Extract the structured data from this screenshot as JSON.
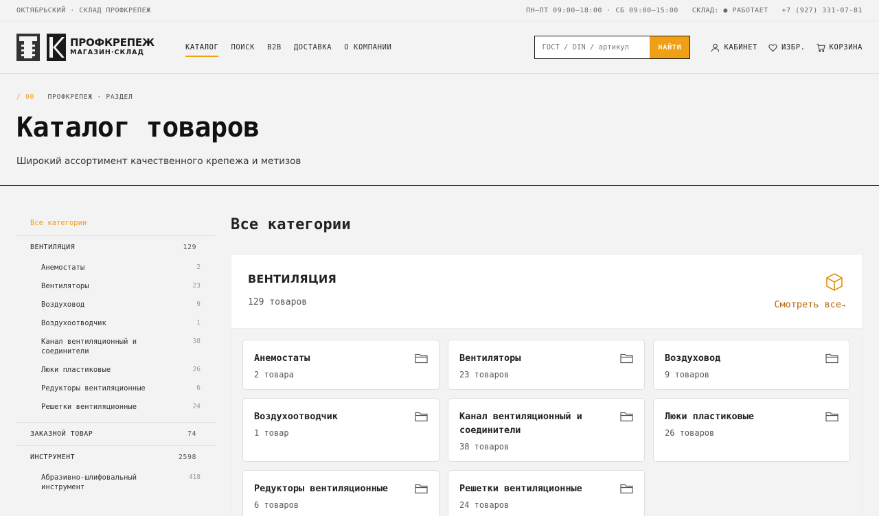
{
  "topbar": {
    "location": "ОКТЯБРЬСКИЙ · СКЛАД ПРОФКРЕПЕЖ",
    "hours": "ПН–ПТ 09:00–18:00 · СБ 09:00–15:00",
    "status": "СКЛАД: ● РАБОТАЕТ",
    "phone": "+7 (927) 331-07-81"
  },
  "header": {
    "logo_name": "ПРОФКРЕПЕЖ",
    "logo_sub": "МАГАЗИН·СКЛАД",
    "nav": [
      "КАТАЛОГ",
      "ПОИСК",
      "B2B",
      "ДОСТАВКА",
      "О КОМПАНИИ"
    ],
    "search_placeholder": "ГОСТ / DIN / артикул",
    "search_button": "НАЙТИ",
    "tools": {
      "cabinet": "КАБИНЕТ",
      "favorites": "ИЗБР.",
      "cart": "КОРЗИНА"
    },
    "accent": "#f0a015"
  },
  "hero": {
    "crumb_num": "/ 00",
    "crumb_text": "ПРОФКРЕПЕЖ · РАЗДЕЛ",
    "title": "Каталог товаров",
    "subtitle": "Широкий ассортимент качественного крепежа и метизов"
  },
  "sidebar": {
    "all": "Все категории",
    "groups": [
      {
        "name": "ВЕНТИЛЯЦИЯ",
        "count": "129",
        "items": [
          {
            "name": "Анемостаты",
            "count": "2"
          },
          {
            "name": "Вентиляторы",
            "count": "23"
          },
          {
            "name": "Воздуховод",
            "count": "9"
          },
          {
            "name": "Воздухоотводчик",
            "count": "1"
          },
          {
            "name": "Канал вентиляционный и соединители",
            "count": "38"
          },
          {
            "name": "Люки пластиковые",
            "count": "26"
          },
          {
            "name": "Редукторы вентиляционные",
            "count": "6"
          },
          {
            "name": "Решетки вентиляционные",
            "count": "24"
          }
        ]
      },
      {
        "name": "ЗАКАЗНОЙ ТОВАР",
        "count": "74",
        "items": []
      },
      {
        "name": "ИНСТРУМЕНТ",
        "count": "2598",
        "items": [
          {
            "name": "Абразивно-шлифовальный инструмент",
            "count": "418"
          }
        ]
      }
    ]
  },
  "content": {
    "title": "Все категории",
    "panel": {
      "title": "ВЕНТИЛЯЦИЯ",
      "count": "129 товаров",
      "see_all": "Смотреть все",
      "arrow": "→",
      "cards": [
        {
          "name": "Анемостаты",
          "count": "2 товара"
        },
        {
          "name": "Вентиляторы",
          "count": "23 товаров"
        },
        {
          "name": "Воздуховод",
          "count": "9 товаров"
        },
        {
          "name": "Воздухоотводчик",
          "count": "1 товар"
        },
        {
          "name": "Канал вентиляционный и соединители",
          "count": "38 товаров"
        },
        {
          "name": "Люки пластиковые",
          "count": "26 товаров"
        },
        {
          "name": "Редукторы вентиляционные",
          "count": "6 товаров"
        },
        {
          "name": "Решетки вентиляционные",
          "count": "24 товаров"
        }
      ]
    }
  }
}
